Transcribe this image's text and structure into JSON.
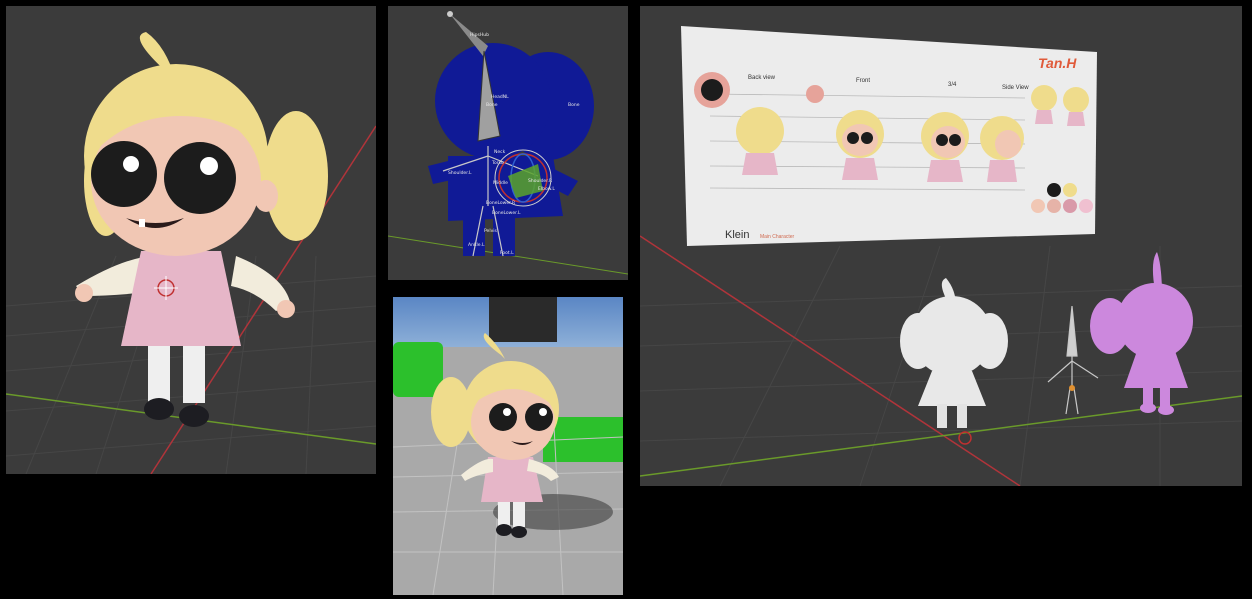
{
  "panels": {
    "character_viewport": {
      "title": ""
    },
    "rig_viewport": {
      "bone_labels": [
        "HipsHub",
        "HeadNL",
        "Bone",
        "Bone",
        "Neck",
        "Torso",
        "Shoulder.L",
        "Shoulder.R",
        "Elbow.L",
        "Middle",
        "BoneLower.R",
        "BoneLower.L",
        "Pelvis",
        "Ankle.L",
        "Foot.L"
      ]
    },
    "game_viewport": {
      "title": ""
    },
    "reference_viewport": {
      "sheet": {
        "logo_text": "Tan.H",
        "labels": [
          "Back view",
          "Front",
          "3/4",
          "Side View"
        ],
        "character_name": "Klein",
        "character_subtitle": "Main Character"
      }
    }
  },
  "colors": {
    "viewport_bg": "#3b3b3b",
    "grid_line": "#484848",
    "axis_x": "#b0343a",
    "axis_y": "#6a9a2a",
    "rig_mesh": "#101a96",
    "character_skin": "#f1c7b4",
    "character_hair": "#efdc8c",
    "character_dress": "#e6b6c8",
    "clay_model": "#e8e8e8",
    "pink_model": "#cc88dd"
  }
}
